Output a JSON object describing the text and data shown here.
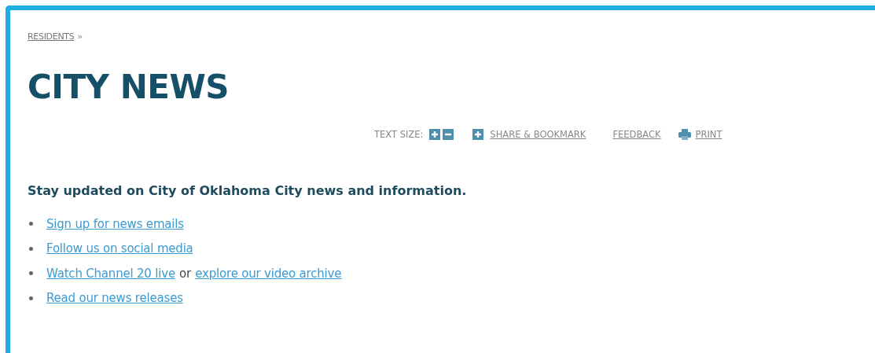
{
  "breadcrumb": {
    "link": "RESIDENTS",
    "separator": "»"
  },
  "title": "CITY NEWS",
  "toolbar": {
    "text_size_label": "TEXT SIZE:",
    "share": "SHARE & BOOKMARK",
    "feedback": "FEEDBACK",
    "print": "PRINT"
  },
  "heading": "Stay updated on City of Oklahoma City news and information.",
  "links": [
    {
      "parts": [
        {
          "kind": "link",
          "text": "Sign up for news emails"
        }
      ]
    },
    {
      "parts": [
        {
          "kind": "link",
          "text": "Follow us on social media"
        }
      ]
    },
    {
      "parts": [
        {
          "kind": "link",
          "text": "Watch Channel 20 live"
        },
        {
          "kind": "text",
          "text": "or"
        },
        {
          "kind": "link",
          "text": "explore our video archive"
        }
      ]
    },
    {
      "parts": [
        {
          "kind": "link",
          "text": "Read our news releases"
        }
      ]
    }
  ]
}
